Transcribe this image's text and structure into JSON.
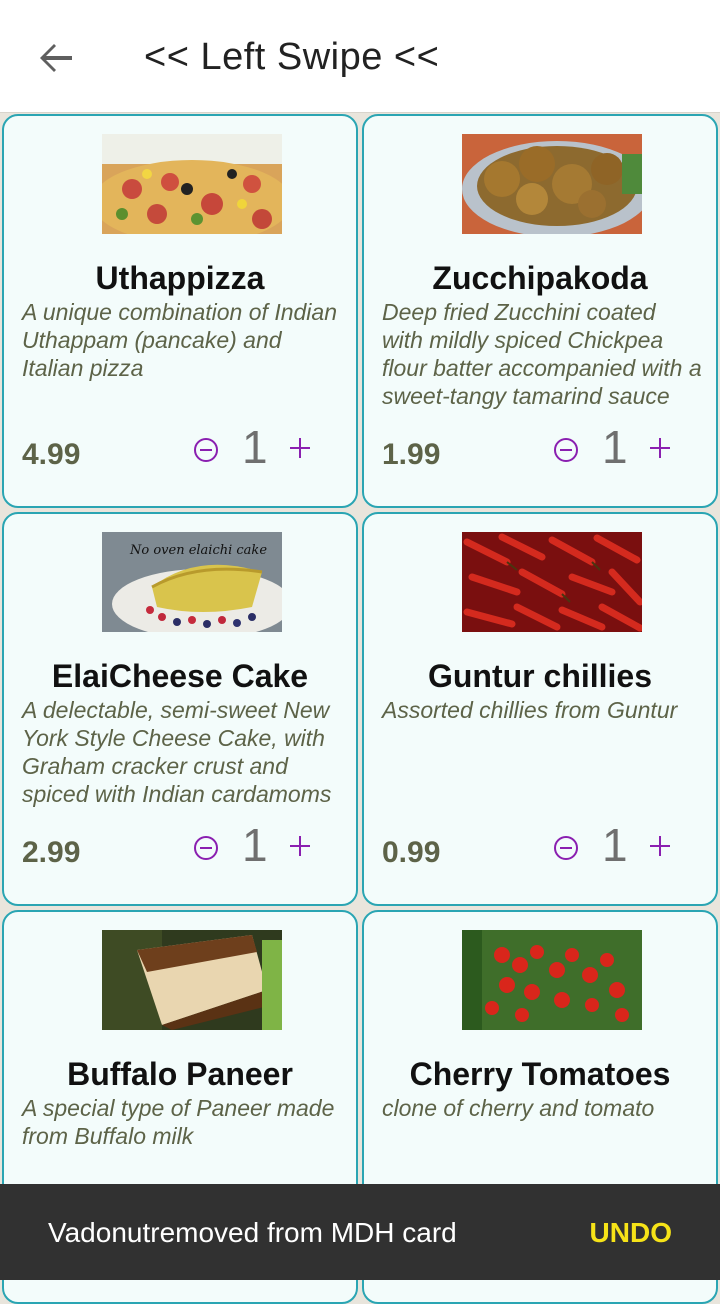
{
  "header": {
    "title": "<< Left Swipe <<",
    "back_icon": "arrow-back-icon"
  },
  "colors": {
    "card_border": "#2aa5b3",
    "accent": "#8a1fb0",
    "price_text": "#5d6348",
    "snackbar_action": "#f6e318"
  },
  "items": [
    {
      "name": "Uthappizza",
      "description": "A unique combination of Indian Uthappam (pancake) and Italian pizza",
      "price": "4.99",
      "quantity": "1",
      "image": "pizza-image"
    },
    {
      "name": "Zucchipakoda",
      "description": "Deep fried Zucchini coated with mildly spiced Chickpea flour batter accompanied with a sweet-tangy tamarind sauce",
      "price": "1.99",
      "quantity": "1",
      "image": "pakoda-image"
    },
    {
      "name": "ElaiCheese Cake",
      "description": "A delectable, semi-sweet New York Style Cheese Cake, with Graham cracker crust and spiced with Indian cardamoms",
      "price": "2.99",
      "quantity": "1",
      "image": "cake-image",
      "image_caption": "No oven elaichi cake"
    },
    {
      "name": "Guntur chillies",
      "description": "Assorted chillies from Guntur",
      "price": "0.99",
      "quantity": "1",
      "image": "chillies-image"
    },
    {
      "name": "Buffalo Paneer",
      "description": "A special type of Paneer made from Buffalo milk",
      "image": "paneer-image"
    },
    {
      "name": "Cherry Tomatoes",
      "description": "clone of cherry and tomato",
      "image": "tomatoes-image"
    }
  ],
  "snackbar": {
    "message": "Vadonutremoved from MDH card",
    "action": "UNDO"
  }
}
